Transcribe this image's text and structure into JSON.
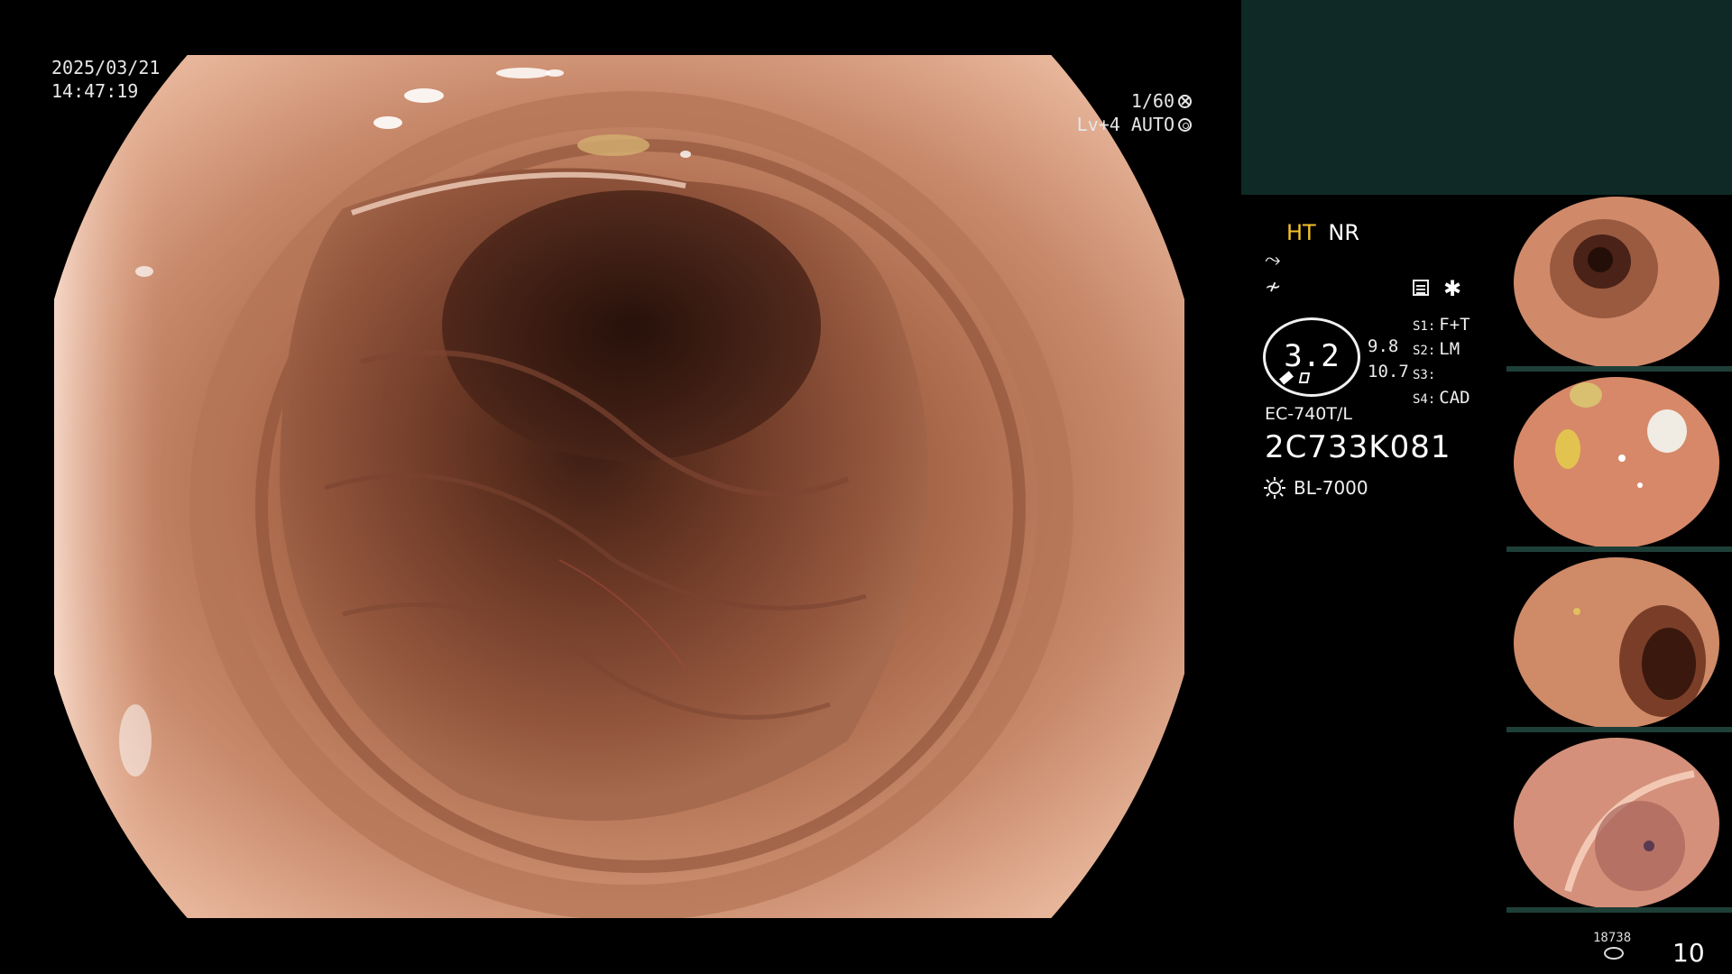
{
  "overlay": {
    "date": "2025/03/21",
    "time": "14:47:19",
    "shutter": "1/60",
    "level": "Lv+4 AUTO"
  },
  "processor": {
    "mode_ht": "HT",
    "mode_nr": "NR",
    "zoom_value": "3.2",
    "side_value_1": "9.8",
    "side_value_2": "10.7",
    "switches": [
      {
        "key": "S1:",
        "value": "F+T"
      },
      {
        "key": "S2:",
        "value": "LM"
      },
      {
        "key": "S3:",
        "value": ""
      },
      {
        "key": "S4:",
        "value": "CAD"
      }
    ],
    "scope_model": "EC-740T/L",
    "scope_serial": "2C733K081",
    "light_source": "BL-7000"
  },
  "footer": {
    "capture_count": "18738",
    "image_index": "10"
  },
  "icons": {
    "shutter": "aperture-icon",
    "level": "auto-iris-icon",
    "lamp": "lamp-icon",
    "storage": "disk-icon",
    "menu": "menu-icon",
    "star": "asterisk-icon"
  },
  "colors": {
    "mode_ht": "#f3c22a",
    "top_panel": "#0f2a26",
    "mucosa": "#c9866a"
  }
}
